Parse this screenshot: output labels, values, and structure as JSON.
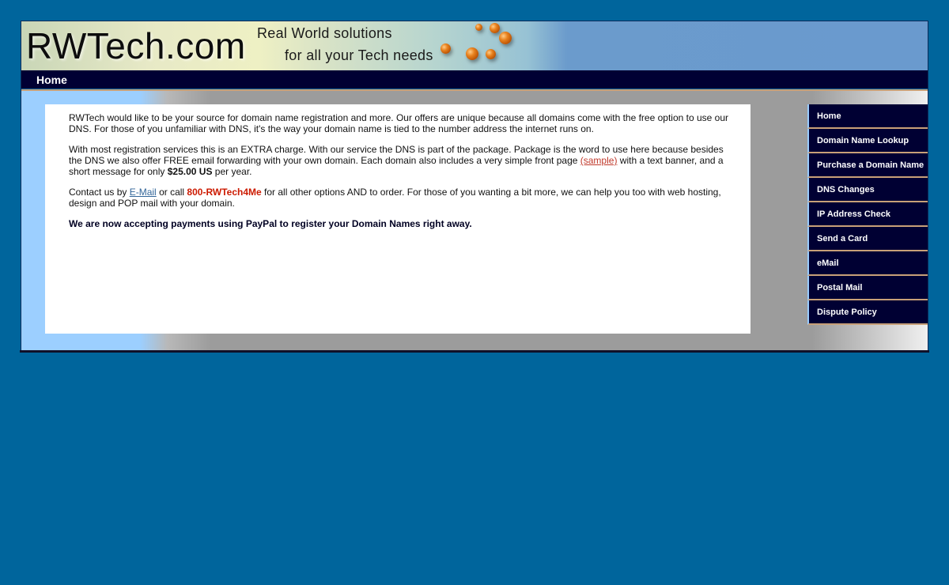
{
  "header": {
    "logo": "RWTech.com",
    "tagline_line1": "Real World solutions",
    "tagline_line2": "for all your Tech needs"
  },
  "nav": {
    "home": "Home"
  },
  "content": {
    "p1": "RWTech would like to be your source for domain name registration and more. Our offers are unique because all domains come with the free option to use our DNS. For those of you unfamiliar with DNS, it's the way your domain name is tied to the number address the internet runs on.",
    "p2_a": "With most registration services this is an EXTRA charge. With our service the DNS is part of the package. Package is the word to use here because besides the DNS we also offer FREE email forwarding with your own domain. Each domain also includes a very simple front page ",
    "p2_link": "(sample)",
    "p2_b": " with a text banner, and a short message for only ",
    "p2_price": "$25.00 US",
    "p2_c": " per year.",
    "p3_a": "Contact us by ",
    "p3_email": "E-Mail",
    "p3_b": " or call ",
    "p3_phone": "800-RWTech4Me",
    "p3_c": " for all other options AND to order. For those of you wanting a bit more, we can help you too with web hosting, design and POP mail with your domain.",
    "p4": "We are now accepting payments using PayPal to register your Domain Names right away."
  },
  "sidebar": {
    "items": [
      {
        "label": "Home"
      },
      {
        "label": "Domain Name Lookup"
      },
      {
        "label": "Purchase a Domain Name"
      },
      {
        "label": "DNS Changes"
      },
      {
        "label": "IP Address Check"
      },
      {
        "label": "Send a Card"
      },
      {
        "label": "eMail"
      },
      {
        "label": "Postal Mail"
      },
      {
        "label": "Dispute Policy"
      }
    ]
  }
}
